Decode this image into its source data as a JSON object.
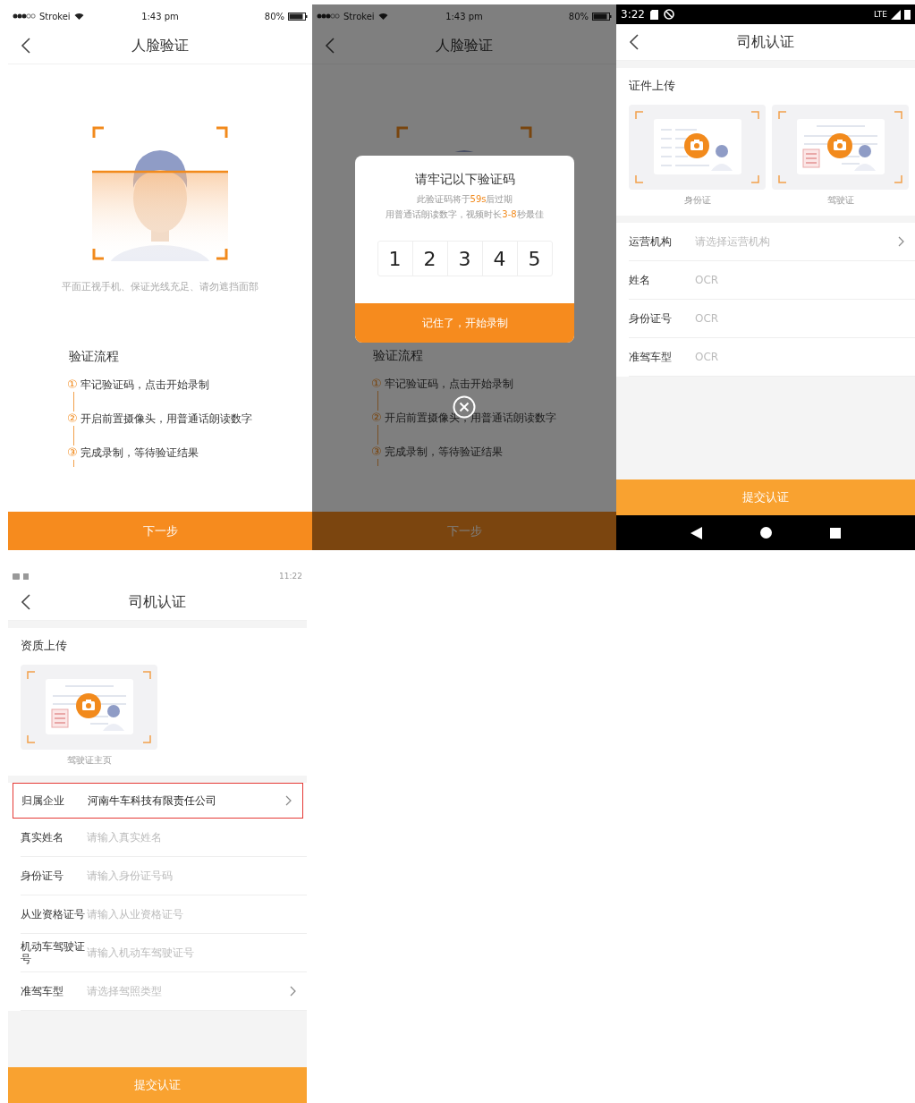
{
  "screens": [
    {
      "kind": "face",
      "status_bar": {
        "kind": "ios",
        "carrier": "Strokei",
        "time": "1:43 pm",
        "battery": "80%"
      },
      "title": "人脸验证",
      "hint": "平面正视手机、保证光线充足、请勿遮挡面部",
      "process_title": "验证流程",
      "steps": [
        {
          "marker": "①",
          "text": "牢记验证码，点击开始录制"
        },
        {
          "marker": "②",
          "text": "开启前置摄像头，用普通话朗读数字"
        },
        {
          "marker": "③",
          "text": "完成录制，等待验证结果"
        }
      ],
      "next_button": "下一步"
    },
    {
      "kind": "face",
      "status_bar": {
        "kind": "ios",
        "carrier": "Strokei",
        "time": "1:43 pm",
        "battery": "80%"
      },
      "title": "人脸验证",
      "process_title": "验证流程",
      "steps": [
        {
          "marker": "①",
          "text": "牢记验证码，点击开始录制"
        },
        {
          "marker": "②",
          "text": "开启前置摄像头，用普通话朗读数字"
        },
        {
          "marker": "③",
          "text": "完成录制，等待验证结果"
        }
      ],
      "next_button": "下一步",
      "modal": {
        "title": "请牢记以下验证码",
        "lines": [
          "此验证码将于**59s**后过期",
          "用普通话朗读数字，视频时长**3-8**秒最佳"
        ],
        "code": [
          "1",
          "2",
          "3",
          "4",
          "5"
        ],
        "confirm_button": "记住了，开始录制"
      }
    },
    {
      "kind": "driver_form",
      "status_bar": {
        "kind": "android_dark",
        "time": "3:22",
        "network": "LTE"
      },
      "title": "司机认证",
      "upload_title": "证件上传",
      "uploads": [
        {
          "kind": "id_card",
          "caption": "身份证"
        },
        {
          "kind": "license",
          "caption": "驾驶证"
        }
      ],
      "fields": [
        {
          "kind": "select",
          "label": "运营机构",
          "placeholder": "请选择运营机构",
          "highlighted": false
        },
        {
          "kind": "input",
          "label": "姓名",
          "placeholder": "OCR",
          "highlighted": false
        },
        {
          "kind": "input",
          "label": "身份证号",
          "placeholder": "OCR",
          "highlighted": false
        },
        {
          "kind": "input",
          "label": "准驾车型",
          "placeholder": "OCR",
          "highlighted": false
        }
      ],
      "submit_button": "提交认证",
      "nav_bar": true
    },
    {
      "kind": "driver_form",
      "status_bar": {
        "kind": "android_light",
        "time": "11:22"
      },
      "title": "司机认证",
      "upload_title": "资质上传",
      "uploads": [
        {
          "kind": "license",
          "caption": "驾驶证主页"
        }
      ],
      "fields": [
        {
          "kind": "select",
          "label": "归属企业",
          "value": "河南牛车科技有限责任公司",
          "highlighted": true
        },
        {
          "kind": "input",
          "label": "真实姓名",
          "placeholder": "请输入真实姓名",
          "highlighted": false
        },
        {
          "kind": "input",
          "label": "身份证号",
          "placeholder": "请输入身份证号码",
          "highlighted": false
        },
        {
          "kind": "input",
          "label": "从业资格证号",
          "placeholder": "请输入从业资格证号",
          "highlighted": false
        },
        {
          "kind": "input",
          "label": "机动车驾驶证号",
          "placeholder": "请输入机动车驾驶证号",
          "highlighted": false
        },
        {
          "kind": "select",
          "label": "准驾车型",
          "placeholder": "请选择驾照类型",
          "highlighted": false
        }
      ],
      "submit_button": "提交认证"
    }
  ]
}
